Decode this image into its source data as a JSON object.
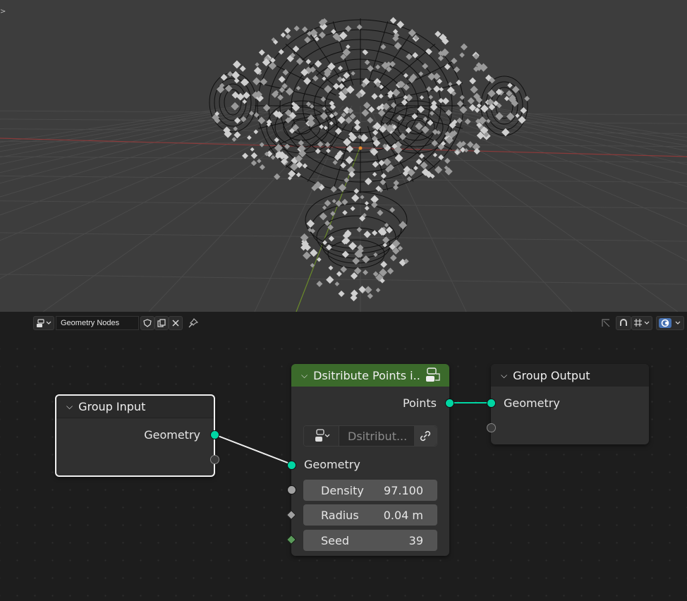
{
  "viewport": {
    "corner_arrow": ">"
  },
  "header": {
    "editor_type_icon": "node-editor-icon",
    "tree_name": "Geometry Nodes",
    "icons": [
      "shield-icon",
      "duplicate-icon",
      "close-icon",
      "pin-icon",
      "parent-icon",
      "snap-icon",
      "overlay-icon",
      "gizmo-icon"
    ]
  },
  "nodes": {
    "group_input": {
      "title": "Group Input",
      "chevron": "⌵",
      "outputs": [
        "Geometry"
      ]
    },
    "distribute": {
      "title": "Dsitribute Points i..",
      "chevron": "⌵",
      "output_label": "Points",
      "mode_value": "Dsitribut...",
      "inputs": {
        "geometry": "Geometry",
        "density_label": "Density",
        "density_value": "97.100",
        "radius_label": "Radius",
        "radius_value": "0.04 m",
        "seed_label": "Seed",
        "seed_value": "39"
      }
    },
    "group_output": {
      "title": "Group Output",
      "chevron": "⌵",
      "inputs": [
        "Geometry"
      ]
    }
  },
  "colors": {
    "geometry_socket": "#00d6a3",
    "distribute_header": "#3b6a2b",
    "io_header": "#1f1f1f"
  }
}
